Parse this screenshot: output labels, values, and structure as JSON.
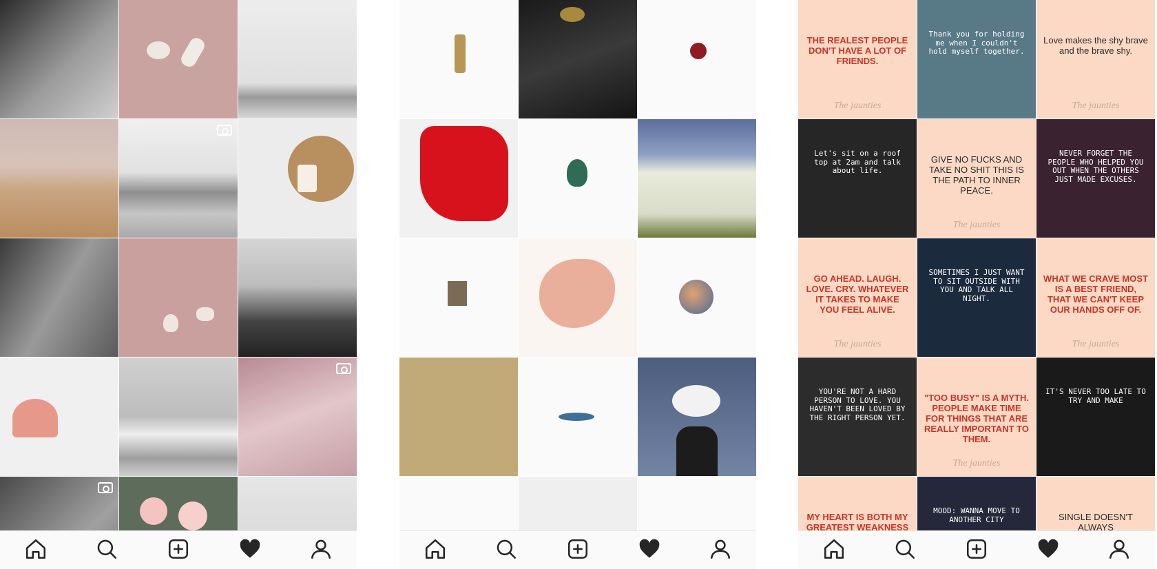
{
  "screens": [
    {
      "name": "feed-pastel-neutral",
      "tabs": [
        "home-icon",
        "search-icon",
        "add-post-icon",
        "heart-icon",
        "profile-icon"
      ],
      "tiles": [
        {
          "bg": "#5a5a5a",
          "kind": "photo"
        },
        {
          "bg": "#c9a3a0",
          "kind": "photo"
        },
        {
          "bg": "#e6e6e6",
          "kind": "photo"
        },
        {
          "bg": "#c8ae98",
          "kind": "photo"
        },
        {
          "bg": "#d9d9d9",
          "kind": "video"
        },
        {
          "bg": "#ebebeb",
          "kind": "photo"
        },
        {
          "bg": "#6a6a6a",
          "kind": "photo"
        },
        {
          "bg": "#c9a09d",
          "kind": "photo"
        },
        {
          "bg": "#8a8a8a",
          "kind": "photo"
        },
        {
          "bg": "#f0f0f0",
          "kind": "photo"
        },
        {
          "bg": "#c6c6c6",
          "kind": "photo"
        },
        {
          "bg": "#d8b8bc",
          "kind": "video"
        },
        {
          "bg": "#7a7a7a",
          "kind": "video"
        },
        {
          "bg": "#8a9a86",
          "kind": "photo"
        },
        {
          "bg": "#dcdcdc",
          "kind": "photo"
        }
      ]
    },
    {
      "name": "feed-white-minimal",
      "tabs": [
        "home-icon",
        "search-icon",
        "add-post-icon",
        "heart-icon",
        "profile-icon"
      ],
      "tiles": [
        {
          "bg": "#fafafa",
          "kind": "photo"
        },
        {
          "bg": "#1e1e1e",
          "kind": "photo"
        },
        {
          "bg": "#fafafa",
          "kind": "photo"
        },
        {
          "bg": "#f1f1f1",
          "kind": "photo"
        },
        {
          "bg": "#fafafa",
          "kind": "photo"
        },
        {
          "bg": "#c9d2dc",
          "kind": "photo"
        },
        {
          "bg": "#fafafa",
          "kind": "photo"
        },
        {
          "bg": "#f6ece7",
          "kind": "photo"
        },
        {
          "bg": "#fafafa",
          "kind": "photo"
        },
        {
          "bg": "#c1aa78",
          "kind": "photo"
        },
        {
          "bg": "#fafafa",
          "kind": "photo"
        },
        {
          "bg": "#4a5a7a",
          "kind": "photo"
        },
        {
          "bg": "#fafafa",
          "kind": "photo"
        },
        {
          "bg": "#f0f0f0",
          "kind": "photo"
        },
        {
          "bg": "#fafafa",
          "kind": "photo"
        }
      ]
    },
    {
      "name": "feed-quotes",
      "tabs": [
        "home-icon",
        "search-icon",
        "add-post-icon",
        "heart-icon",
        "profile-icon"
      ],
      "tiles": [
        {
          "bg": "#fbd9c4",
          "kind": "quote",
          "style": "dark",
          "text": "THE REALEST PEOPLE DON'T HAVE A LOT OF FRIENDS.",
          "sig": "The jaunties"
        },
        {
          "bg": "#587a86",
          "kind": "quote",
          "style": "light",
          "text": "Thank you for holding me when I couldn't hold myself together.",
          "sig": ""
        },
        {
          "bg": "#fbd9c4",
          "kind": "quote",
          "style": "plain",
          "text": "Love makes the shy brave and the brave shy.",
          "sig": "The jaunties"
        },
        {
          "bg": "#262626",
          "kind": "quote",
          "style": "light",
          "text": "Let's sit on a roof top at 2am and talk about life.",
          "sig": ""
        },
        {
          "bg": "#fbd9c4",
          "kind": "quote",
          "style": "plain",
          "text": "GIVE NO FUCKS AND TAKE NO SHIT THIS IS THE PATH TO INNER PEACE.",
          "sig": "The jaunties"
        },
        {
          "bg": "#3a2230",
          "kind": "quote",
          "style": "light",
          "text": "NEVER FORGET THE PEOPLE WHO HELPED YOU OUT WHEN THE OTHERS JUST MADE EXCUSES.",
          "sig": ""
        },
        {
          "bg": "#fbd9c4",
          "kind": "quote",
          "style": "dark",
          "text": "GO AHEAD. LAUGH. LOVE. CRY. WHATEVER IT TAKES TO MAKE YOU FEEL ALIVE.",
          "sig": "The jaunties"
        },
        {
          "bg": "#1c2a3e",
          "kind": "quote",
          "style": "light",
          "text": "SOMETIMES I JUST WANT TO SIT OUTSIDE WITH YOU AND TALK ALL NIGHT.",
          "sig": ""
        },
        {
          "bg": "#fbd9c4",
          "kind": "quote",
          "style": "dark",
          "text": "WHAT WE CRAVE MOST IS A BEST FRIEND, THAT WE CAN'T KEEP OUR HANDS OFF OF.",
          "sig": "The jaunties"
        },
        {
          "bg": "#2c2c2c",
          "kind": "quote",
          "style": "light",
          "text": "YOU'RE NOT A HARD PERSON TO LOVE. YOU HAVEN'T BEEN LOVED BY THE RIGHT PERSON YET.",
          "sig": ""
        },
        {
          "bg": "#fbd9c4",
          "kind": "quote",
          "style": "dark",
          "text": "\"TOO BUSY\" IS A MYTH. PEOPLE MAKE TIME FOR THINGS THAT ARE REALLY IMPORTANT TO THEM.",
          "sig": "The jaunties"
        },
        {
          "bg": "#1a1a1a",
          "kind": "quote",
          "style": "light",
          "text": "IT'S NEVER TOO LATE TO TRY AND MAKE",
          "sig": ""
        },
        {
          "bg": "#fbd9c4",
          "kind": "quote",
          "style": "dark",
          "text": "MY HEART IS BOTH MY GREATEST WEAKNESS",
          "sig": ""
        },
        {
          "bg": "#24283a",
          "kind": "quote",
          "style": "light",
          "text": "MOOD: WANNA MOVE TO ANOTHER CITY",
          "sig": ""
        },
        {
          "bg": "#fbd9c4",
          "kind": "quote",
          "style": "plain",
          "text": "SINGLE DOESN'T ALWAYS",
          "sig": ""
        }
      ]
    }
  ]
}
